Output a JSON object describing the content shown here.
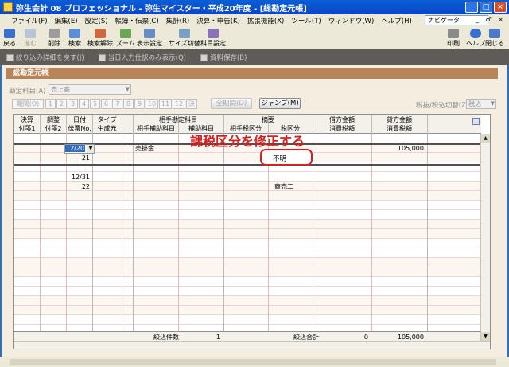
{
  "window": {
    "title": "弥生会計 08 プロフェッショナル - 弥生マイスター・平成20年度 - [総勘定元帳]",
    "controls": [
      "_",
      "□",
      "×"
    ]
  },
  "menubar": {
    "items": [
      "ファイル(F)",
      "編集(E)",
      "設定(S)",
      "帳簿・伝票(C)",
      "集計(R)",
      "決算・申告(K)",
      "拡張機能(X)",
      "ツール(T)",
      "ウィンドウ(W)",
      "ヘルプ(H)"
    ],
    "navi_label": "ナビゲータ",
    "doc_controls": "_ ♂ ×"
  },
  "toolbar": {
    "back": "戻る",
    "forward": "進む",
    "delete": "削除",
    "search": "検索",
    "clear_search": "検索解除",
    "zoom": "ズーム",
    "display_settings": "表示設定",
    "size_toggle": "サイズ切替",
    "account_settings": "科目設定",
    "print": "印刷",
    "help": "ヘルプ",
    "close": "閉じる"
  },
  "subbar": {
    "items": [
      "絞り込み詳細を戻す(J)",
      "当日入力仕訳のみ表示(Q)",
      "資料保存(B)"
    ]
  },
  "panel": {
    "title": "総勘定元帳",
    "account_label": "勘定科目(A)",
    "account_value": "売上高",
    "period_label": "期間(O)",
    "months": [
      "1",
      "2",
      "3",
      "4",
      "5",
      "6",
      "7",
      "8",
      "9",
      "10",
      "11",
      "12",
      "決"
    ],
    "all_period_button": "全期間(D)",
    "jump_button": "ジャンプ(M)",
    "tax_toggle_label": "税抜/税込切替(Z)",
    "tax_toggle_value": "税込"
  },
  "grid": {
    "header_top": [
      "決算",
      "調整",
      "日付",
      "タイプ",
      "相手勘定科目",
      "摘要",
      "借方金額",
      "貸方金額"
    ],
    "header_bottom": [
      "付箋1",
      "付箋2",
      "伝票No.",
      "生成元",
      "相手補助科目",
      "補助科目",
      "相手税区分",
      "税区分",
      "消費税額",
      "消費税額"
    ],
    "rows": [
      {
        "date": "12/20",
        "counter_account": "売掛金",
        "credit": "105,000"
      },
      {
        "voucher_no": "21",
        "tax_category": "不明"
      },
      {
        "date": "12/31"
      },
      {
        "voucher_no": "22",
        "summary": "商売二"
      }
    ],
    "footer": {
      "count_label": "絞込件数",
      "count_value": "1",
      "total_label": "絞込合計",
      "debit_total": "0",
      "credit_total": "105,000"
    }
  },
  "annotation": "課税区分を修正する",
  "colors": {
    "title_bar": "#0a46c4",
    "panel_header": "#b8845a",
    "annotation": "#d62020",
    "selection": "#316ac5"
  }
}
